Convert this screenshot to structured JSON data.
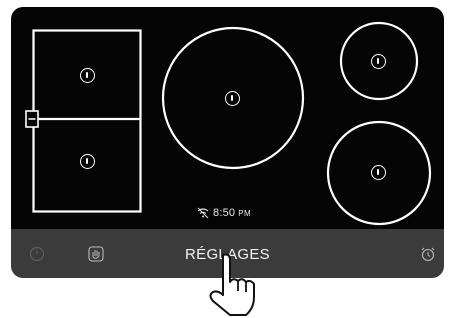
{
  "status": {
    "time": "8:50",
    "meridiem": "PM",
    "icon": "wifi-off-icon"
  },
  "bottom_bar": {
    "settings_label": "RÉGLAGES"
  },
  "icons": {
    "power": "power-icon",
    "bridge": "hand-icon",
    "timer": "alarm-clock-icon",
    "pointer": "pointing-hand-icon"
  }
}
